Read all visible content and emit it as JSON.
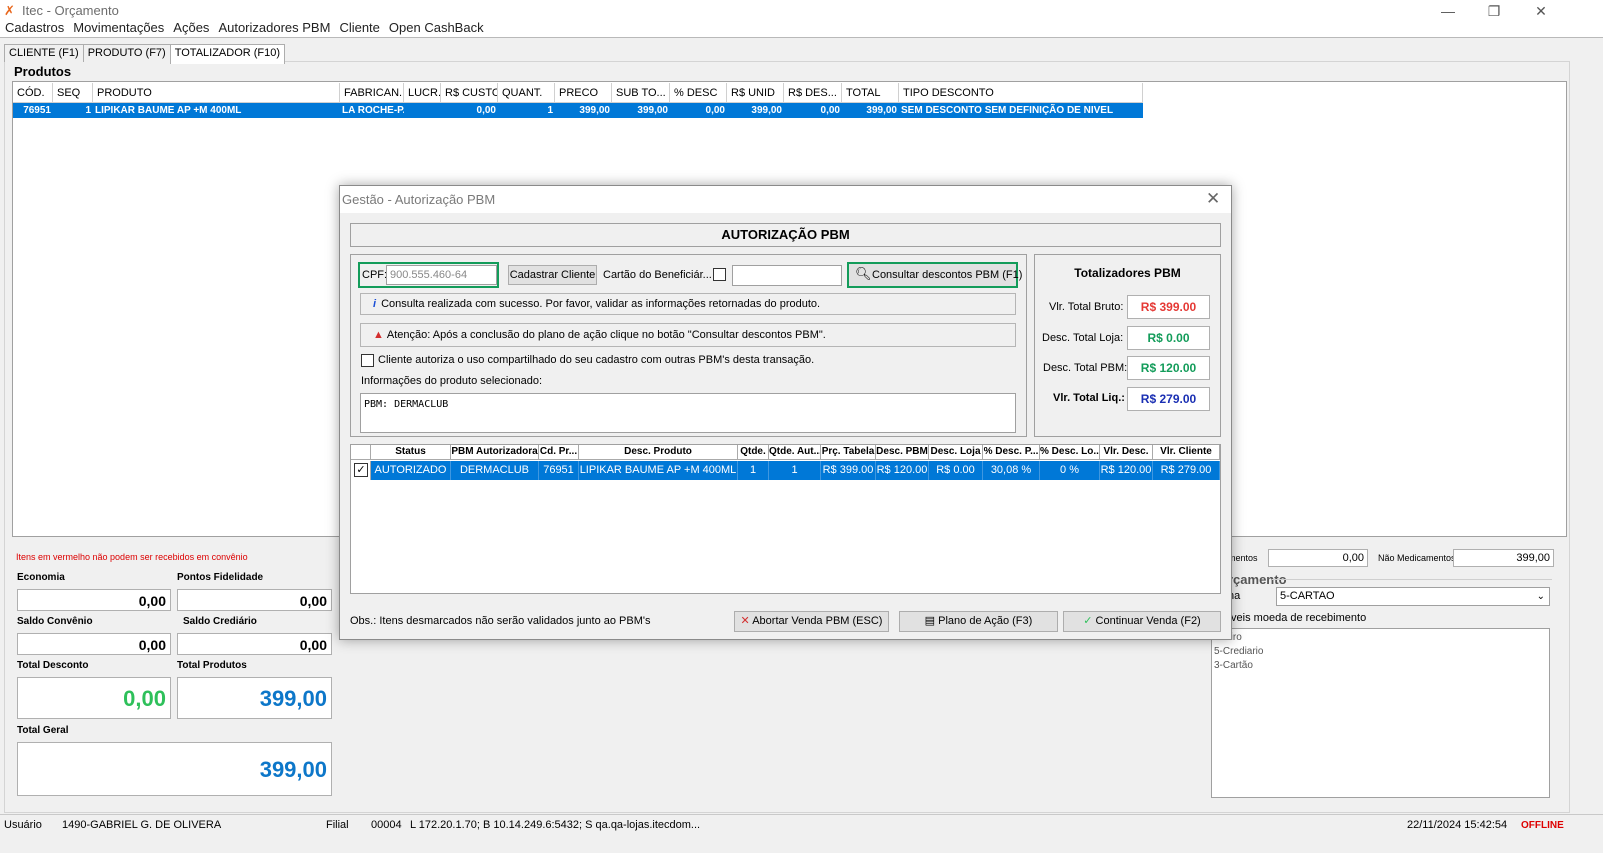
{
  "window": {
    "title": "Itec - Orçamento"
  },
  "menu": [
    "Cadastros",
    "Movimentações",
    "Ações",
    "Autorizadores PBM",
    "Cliente",
    "Open CashBack"
  ],
  "tabs": [
    "CLIENTE (F1)",
    "PRODUTO (F7)",
    "TOTALIZADOR (F10)"
  ],
  "products": {
    "label": "Produtos",
    "columns": [
      "CÓD.",
      "SEQ",
      "PRODUTO",
      "FABRICAN...",
      "LUCR.",
      "R$ CUSTO",
      "QUANT.",
      "PRECO",
      "SUB TO...",
      "% DESC",
      "R$ UNID",
      "R$ DES...",
      "TOTAL",
      "TIPO DESCONTO"
    ],
    "row": [
      "76951",
      "1",
      "LIPIKAR BAUME AP +M 400ML",
      "LA ROCHE-P...",
      "",
      "0,00",
      "1",
      "399,00",
      "399,00",
      "0,00",
      "399,00",
      "0,00",
      "399,00",
      "SEM DESCONTO SEM DEFINIÇÃO DE NIVEL"
    ]
  },
  "bottom": {
    "note": "Itens em vermelho não podem ser recebidos em convênio",
    "economia_label": "Economia",
    "economia": "0,00",
    "pontos_label": "Pontos Fidelidade",
    "pontos": "0,00",
    "saldo_conv_label": "Saldo Convênio",
    "saldo_conv": "0,00",
    "saldo_cred_label": "Saldo Crediário",
    "saldo_cred": "0,00",
    "total_desc_label": "Total Desconto",
    "total_desc": "0,00",
    "total_prod_label": "Total Produtos",
    "total_prod": "399,00",
    "total_geral_label": "Total Geral",
    "total_geral": "399,00"
  },
  "right_panel": {
    "medicamentos_label": "mentos",
    "medicamentos": "0,00",
    "nao_medicamentos_label": "Não Medicamentos",
    "nao_medicamentos": "399,00",
    "orcamento_label": "rçamento",
    "forma_label": "na",
    "forma_value": "5-CARTAO",
    "moedas_label": "íveis moeda de recebimento",
    "moedas": [
      "nheiro",
      "5-Crediario",
      "3-Cartão"
    ]
  },
  "status": {
    "usuario_label": "Usuário",
    "usuario": "1490-GABRIEL G. DE OLIVERA",
    "filial_label": "Filial",
    "filial": "00004",
    "conn": "L 172.20.1.70; B 10.14.249.6:5432; S qa.qa-lojas.itecdom...",
    "datetime": "22/11/2024 15:42:54",
    "mode": "OFFLINE"
  },
  "dialog": {
    "title": "Gestão - Autorização PBM",
    "header": "AUTORIZAÇÃO PBM",
    "cpf_label": "CPF:",
    "cpf_value": "900.555.460-64",
    "cadastrar": "Cadastrar Cliente",
    "cartao_label": "Cartão do Beneficiár...",
    "consultar": "Consultar descontos PBM (F1)",
    "info_msg": "Consulta realizada com sucesso. Por favor, validar as informações retornadas do produto.",
    "warn_msg": "Atenção: Após a conclusão do plano de ação clique no botão \"Consultar descontos PBM\".",
    "consent": "Cliente autoriza o uso compartilhado do seu cadastro com outras PBM's desta transação.",
    "prod_info_label": "Informações do produto selecionado:",
    "prod_info": "PBM: DERMACLUB",
    "totals_title": "Totalizadores PBM",
    "bruto_label": "Vlr. Total Bruto:",
    "bruto": "R$ 399.00",
    "desc_loja_label": "Desc. Total Loja:",
    "desc_loja": "R$ 0.00",
    "desc_pbm_label": "Desc. Total PBM:",
    "desc_pbm": "R$ 120.00",
    "liq_label": "Vlr. Total Liq.:",
    "liq": "R$ 279.00",
    "grid_columns": [
      "Status",
      "PBM Autorizadora",
      "Cd. Pr...",
      "Desc. Produto",
      "Qtde.",
      "Qtde. Aut...",
      "Prç. Tabela",
      "Desc. PBM",
      "Desc. Loja",
      "% Desc. P...",
      "% Desc. Lo...",
      "Vlr. Desc.",
      "Vlr. Cliente"
    ],
    "grid_row": [
      "AUTORIZADO",
      "DERMACLUB",
      "76951",
      "LIPIKAR BAUME AP +M 400ML",
      "1",
      "1",
      "R$ 399.00",
      "R$ 120.00",
      "R$ 0.00",
      "30,08 %",
      "0 %",
      "R$ 120.00",
      "R$ 279.00"
    ],
    "obs": "Obs.: Itens desmarcados não serão validados junto ao PBM's",
    "abortar": "Abortar Venda PBM (ESC)",
    "plano": "Plano de Ação (F3)",
    "continuar": "Continuar Venda (F2)"
  },
  "colors": {
    "accent": "#0078d7",
    "green": "#139c5a",
    "red": "#e53935",
    "blue_value": "#0d77c9",
    "green_value": "#2ec05a"
  }
}
